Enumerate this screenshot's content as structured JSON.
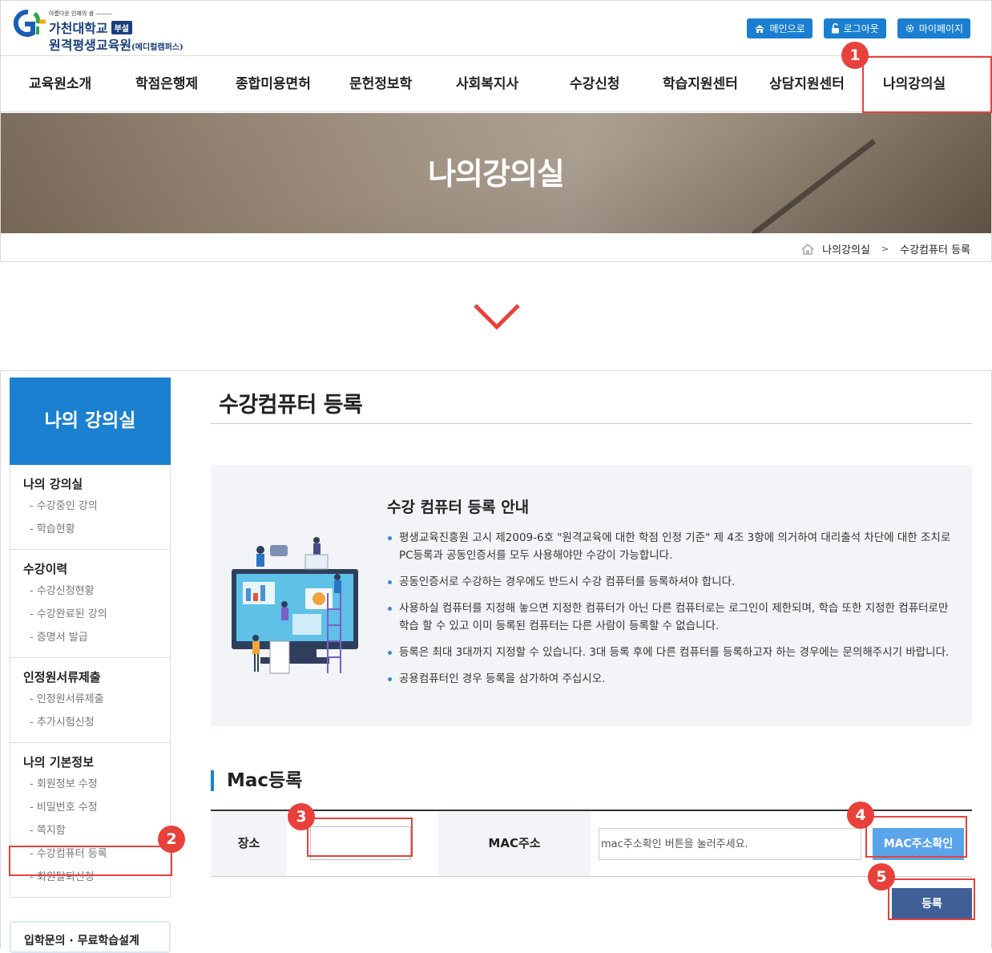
{
  "logo": {
    "tagline": "아름다운 인재의 샘 ———",
    "line1": "가천대학교",
    "badge": "부설",
    "line2": "원격평생교육원",
    "line2_suffix": "(메디컬캠퍼스)"
  },
  "util": [
    {
      "label": "메인으로",
      "icon": "home-icon"
    },
    {
      "label": "로그아웃",
      "icon": "unlock-icon"
    },
    {
      "label": "마이페이지",
      "icon": "gear-icon"
    }
  ],
  "gnb": [
    "교육원소개",
    "학점은행제",
    "종합미용면허",
    "문헌정보학",
    "사회복지사",
    "수강신청",
    "학습지원센터",
    "상담지원센터",
    "나의강의실"
  ],
  "hero": {
    "title": "나의강의실"
  },
  "breadcrumb": {
    "home_icon": "home-icon",
    "level1": "나의강의실",
    "sep": ">",
    "level2": "수강컴퓨터 등록"
  },
  "steps": [
    "1",
    "2",
    "3",
    "4",
    "5"
  ],
  "colors": {
    "accent": "#1b80cf",
    "highlight": "#e8413b",
    "mac_button": "#5aa4ea",
    "register_button": "#3f5f97"
  },
  "lnb": {
    "title": "나의 강의실",
    "groups": [
      {
        "title": "나의 강의실",
        "items": [
          "- 수강중인 강의",
          "- 학습현황"
        ]
      },
      {
        "title": "수강이력",
        "items": [
          "- 수강신청현황",
          "- 수강완료된 강의",
          "- 증명서 발급"
        ]
      },
      {
        "title": "인정원서류제출",
        "items": [
          "- 인정원서류제출",
          "- 추가시험신청"
        ]
      },
      {
        "title": "나의 기본정보",
        "items": [
          "- 회원정보 수정",
          "- 비밀번호 수정",
          "- 쪽지함",
          "- 수강컴퓨터 등록",
          "- 회원탈퇴신청"
        ]
      }
    ],
    "quick": "입학문의 · 무료학습설계"
  },
  "content": {
    "title": "수강컴퓨터 등록",
    "guide": {
      "title": "수강 컴퓨터 등록 안내",
      "items": [
        "평생교육진흥원 고시 제2009-6호 \"원격교육에 대한 학점 인정 기준\" 제 4조 3항에 의거하여 대리출석 차단에 대한 조치로 PC등록과 공동인증서를 모두 사용해야만 수강이 가능합니다.",
        "공동인증서로 수강하는 경우에도 반드시 수강 컴퓨터를 등록하셔야 합니다.",
        "사용하실 컴퓨터를 지정해 놓으면 지정한 컴퓨터가 아닌 다른 컴퓨터로는 로그인이 제한되며, 학습 또한 지정한 컴퓨터로만 학습 할 수 있고 이미 등록된 컴퓨터는 다른 사람이 등록할 수 없습니다.",
        "등록은 최대 3대까지 지정할 수 있습니다. 3대 등록 후에 다른 컴퓨터를 등록하고자 하는 경우에는 문의해주시기 바랍니다.",
        "공용컴퓨터인 경우 등록을 삼가하여 주십시오."
      ]
    },
    "mac": {
      "title": "Mac등록",
      "place_label": "장소",
      "place_value": "",
      "mac_label": "MAC주소",
      "mac_placeholder": "mac주소확인 버튼을 눌러주세요.",
      "check_button": "MAC주소확인",
      "register_button": "등록"
    }
  }
}
